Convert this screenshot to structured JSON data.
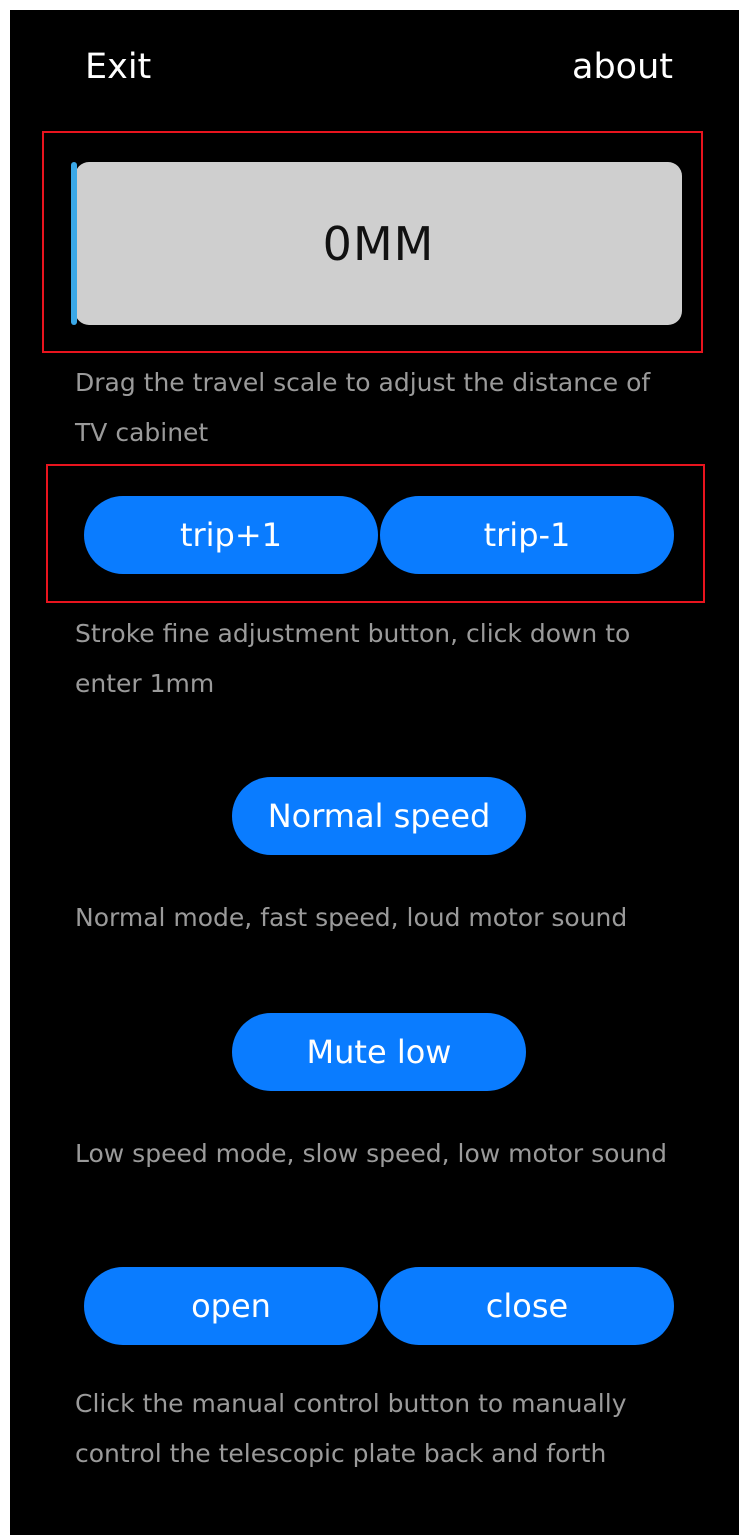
{
  "header": {
    "exit_label": "Exit",
    "about_label": "about"
  },
  "travel_scale": {
    "value_text": "0MM",
    "position_fraction": 0,
    "description": "Drag the travel scale to adjust the distance of TV cabinet"
  },
  "trip_buttons": {
    "plus_label": "trip+1",
    "minus_label": "trip-1",
    "description": "Stroke fine adjustment button, click down to enter 1mm"
  },
  "normal_mode": {
    "label": "Normal speed",
    "description": "Normal mode, fast speed, loud motor sound"
  },
  "low_mode": {
    "label": "Mute low",
    "description": "Low speed mode, slow speed, low motor sound"
  },
  "manual_control": {
    "open_label": "open",
    "close_label": "close",
    "description": "Click the manual control button to manually control the telescopic plate back and forth"
  },
  "colors": {
    "background": "#000000",
    "button_blue": "#0a7cff",
    "highlight_red": "#e8141e",
    "scale_track": "#cfcfcf",
    "scale_handle": "#3aa8e8",
    "description_text": "#9a9a9a"
  }
}
